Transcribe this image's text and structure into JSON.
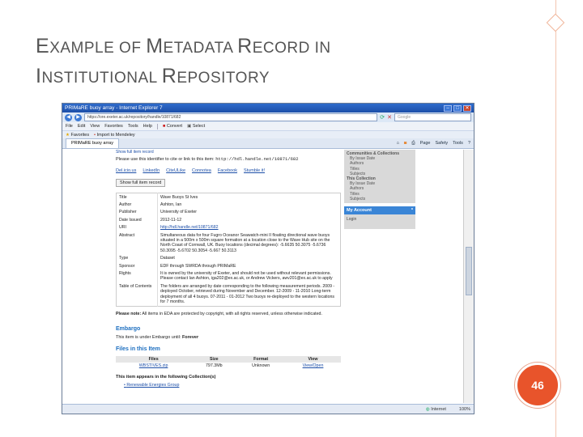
{
  "slide": {
    "title_line1_caps": [
      "E",
      "XAMPLE OF ",
      "M",
      "ETADATA ",
      "R",
      "ECORD IN"
    ],
    "title_line2_caps": [
      "I",
      "NSTITUTIONAL ",
      "R",
      "EPOSITORY"
    ],
    "page_number": "46"
  },
  "browser": {
    "window_title": "PRIMaRE buoy array - Internet Explorer 7",
    "url": "https://ore.exeter.ac.uk/repository/handle/10871/682",
    "search_placeholder": "Google",
    "menu": [
      "File",
      "Edit",
      "View",
      "Favorites",
      "Tools",
      "Help"
    ],
    "menu_convert": "Convert",
    "menu_select": "Select",
    "favorites_label": "Favorites",
    "favorites_item": "Import to Mendeley",
    "tab_label": "PRIMaRE buoy array",
    "tools": [
      "Page",
      "Safety",
      "Tools"
    ],
    "status_zone": "Internet",
    "status_zoom": "100%"
  },
  "page": {
    "top_link": "Show full item record",
    "cite_prefix": "Please use this identifier to cite or link to this item:",
    "cite_url": "http://hdl.handle.net/10871/682",
    "share": [
      "Del.icio.us",
      "LinkedIn",
      "CiteULike",
      "Connotea",
      "Facebook",
      "Stumble it!"
    ],
    "full_record_button": "Show full item record",
    "metadata": [
      {
        "k": "Title",
        "v": "Wave Buoys St Ives"
      },
      {
        "k": "Author",
        "v": "Ashton, Ian"
      },
      {
        "k": "Publisher",
        "v": "University of Exeter"
      },
      {
        "k": "Date Issued",
        "v": "2012-11-12"
      },
      {
        "k": "URI",
        "v": "http://hdl.handle.net/10871/682"
      },
      {
        "k": "Abstract",
        "v": "Simultaneous data for four Fugro Oceanor Seawatch-mini II floating directional wave buoys situated in a 500m x 500m square formation at a location close to the Wave Hub site on the North Coast of Cornwall, UK. Buoy locations (decimal degrees): -5.6635 50.3075 -5.6736 50.3095 -5.6702 50.3054 -5.667 50.3113"
      },
      {
        "k": "Type",
        "v": "Dataset"
      },
      {
        "k": "Sponsor",
        "v": "EDF through SWRDA through PRIMaRE"
      },
      {
        "k": "Rights",
        "v": "It is owned by the university of Exeter, and should not be used without relevant permissions. Please contact Ian Ashton, iga202@ex.ac.uk, or Andrew Vickers, awv201@ex.ac.uk to apply"
      },
      {
        "k": "Table of Contents",
        "v": "The folders are arranged by date corresponding to the following measurement periods. 2009 - deployed October, retrieved during November and December. 12-2009 - 11-2010 Long-term deployment of all 4 buoys. 07-2011 - 01-2012 Two buoys re-deployed to the western locations for 7 months."
      }
    ],
    "note_bold": "Please note:",
    "note_text": "All items in EDA are protected by copyright, with all rights reserved, unless otherwise indicated.",
    "embargo_heading": "Embargo",
    "embargo_text": "This item is under Embargo until:",
    "embargo_value": "Forever",
    "files_heading": "Files in this Item",
    "files_headers": [
      "Files",
      "Size",
      "Format",
      "View"
    ],
    "files_row": [
      "WBSTIVES.zip",
      "797.3Mb",
      "Unknown",
      "View/Open"
    ],
    "collections_text": "This item appears in the following Collection(s)",
    "collection_item": "Renewable Energies Group"
  },
  "sidebar": {
    "group1_header": "Communities & Collections",
    "group1_items": [
      "By Issue Date",
      "Authors",
      "Titles",
      "Subjects"
    ],
    "group2_header": "This Collection",
    "group2_items": [
      "By Issue Date",
      "Authors",
      "Titles",
      "Subjects"
    ],
    "account_label": "My Account",
    "login_label": "Login"
  }
}
